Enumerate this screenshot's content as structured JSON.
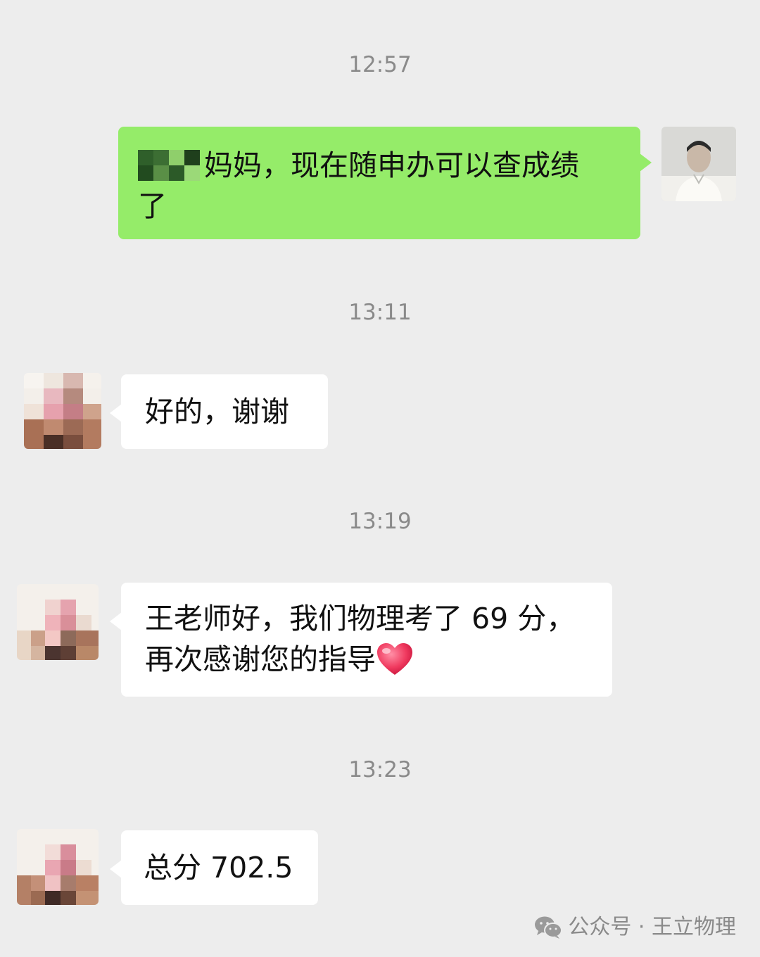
{
  "messages": [
    {
      "time": "12:57",
      "direction": "outgoing",
      "text": "妈妈，现在随申办可以查成绩了"
    },
    {
      "time": "13:11",
      "direction": "incoming",
      "text": "好的，谢谢"
    },
    {
      "time": "13:19",
      "direction": "incoming",
      "text": "王老师好，我们物理考了 69 分，再次感谢您的指导"
    },
    {
      "time": "13:23",
      "direction": "incoming",
      "text": "总分 702.5"
    }
  ],
  "lines": {
    "m1_line1": "妈妈，现在随申办可以查成绩",
    "m1_line2": "了",
    "m3_line1": "王老师好，我们物理考了 69 分，",
    "m3_line2": "再次感谢您的指导"
  },
  "watermark": {
    "text": "公众号 · 王立物理",
    "icon": "wechat-icon"
  },
  "colors": {
    "outgoing_bubble": "#95ec69",
    "incoming_bubble": "#ffffff",
    "background": "#ededed"
  }
}
